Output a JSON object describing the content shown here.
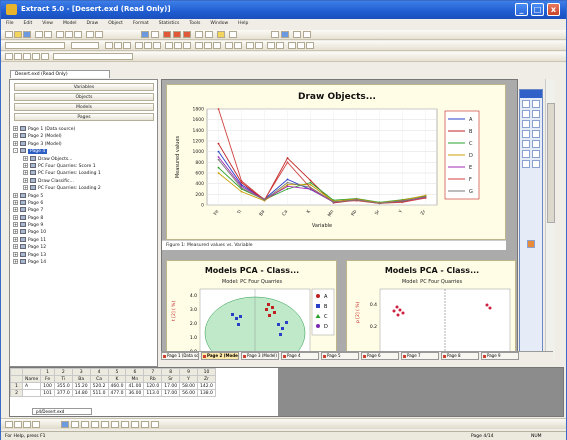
{
  "window": {
    "title": "Extract 5.0 - [Desert.exd (Read Only)]",
    "minimize_glyph": "_",
    "maximize_glyph": "□",
    "close_glyph": "x"
  },
  "menu": [
    "File",
    "Edit",
    "View",
    "Model",
    "Draw",
    "Object",
    "Format",
    "Statistics",
    "Tools",
    "Window",
    "Help"
  ],
  "document_tab": "Desert.exd (Read Only)",
  "left_buttons": [
    "Variables",
    "Objects",
    "Models",
    "Pages"
  ],
  "tree": [
    {
      "label": "Page 1 (Data source)",
      "level": 0,
      "expander": "+"
    },
    {
      "label": "Page 2 (Model)",
      "level": 0,
      "expander": "+"
    },
    {
      "label": "Page 3 (Model)",
      "level": 0,
      "expander": "+"
    },
    {
      "label": "Page 4",
      "level": 0,
      "expander": "-",
      "selected": true
    },
    {
      "label": "Draw Objects...",
      "level": 1,
      "expander": "+"
    },
    {
      "label": "PC Four Quarries: Score 1",
      "level": 1,
      "expander": "+"
    },
    {
      "label": "PC Four Quarries: Loading 1",
      "level": 1,
      "expander": "+"
    },
    {
      "label": "Draw Classific...",
      "level": 1,
      "expander": "+"
    },
    {
      "label": "PC Four Quarries: Loading 2",
      "level": 1,
      "expander": "+"
    },
    {
      "label": "Page 5",
      "level": 0,
      "expander": "+"
    },
    {
      "label": "Page 6",
      "level": 0,
      "expander": "+"
    },
    {
      "label": "Page 7",
      "level": 0,
      "expander": "+"
    },
    {
      "label": "Page 8",
      "level": 0,
      "expander": "+"
    },
    {
      "label": "Page 9",
      "level": 0,
      "expander": "+"
    },
    {
      "label": "Page 10",
      "level": 0,
      "expander": "+"
    },
    {
      "label": "Page 11",
      "level": 0,
      "expander": "+"
    },
    {
      "label": "Page 12",
      "level": 0,
      "expander": "+"
    },
    {
      "label": "Page 13",
      "level": 0,
      "expander": "+"
    },
    {
      "label": "Page 14",
      "level": 0,
      "expander": "+"
    }
  ],
  "figure_caption": "Figure 1: Measured values vs. Variable",
  "small_chart_left": {
    "title": "Models PCA - Class...",
    "subtitle": "Model: PC Four Quarries",
    "ylabel": "t [2] ( %)",
    "yticks": [
      "4.0",
      "3.0",
      "2.0",
      "1.0",
      "0.0"
    ],
    "legend": [
      "A",
      "B",
      "C",
      "D"
    ]
  },
  "small_chart_right": {
    "title": "Models PCA - Class...",
    "subtitle": "Model: PC Four Quarries",
    "ylabel": "p [2] ( %)",
    "yticks": [
      "0.4",
      "0.2"
    ]
  },
  "page_tabs": [
    "Page 1 (Data source)",
    "Page 2 (Model)",
    "Page 3 (Model)",
    "Page 4",
    "Page 5",
    "Page 6",
    "Page 7",
    "Page 8",
    "Page 9"
  ],
  "active_page_tab": 1,
  "grid": {
    "col_numbers": [
      "",
      "1",
      "2",
      "3",
      "4",
      "5",
      "6",
      "7",
      "8",
      "9",
      "10"
    ],
    "header": [
      "Name",
      "Fe",
      "Ti",
      "Ba",
      "Ca",
      "K",
      "Mn",
      "Rb",
      "Sr",
      "Y",
      "Zr"
    ],
    "rows": [
      [
        "A",
        "100",
        "355.0",
        "15.20",
        "520.2",
        "460.0",
        "41.00",
        "120.0",
        "17.00",
        "58.00",
        "142.0"
      ],
      [
        "",
        "101",
        "377.0",
        "14.80",
        "511.0",
        "477.0",
        "36.00",
        "113.0",
        "17.00",
        "56.00",
        "138.0"
      ]
    ],
    "row_numbers": [
      "1",
      "2"
    ],
    "sheet_tab": "p4/Desert.exd"
  },
  "status": {
    "left": "For Help, press F1",
    "page": "Page 4/14",
    "num": "NUM"
  },
  "colors": {
    "accent": "#2c5ec4",
    "titlebar": "#1f5cd0"
  },
  "chart_data": {
    "type": "line",
    "title": "Draw Objects...",
    "xlabel": "Variable",
    "ylabel": "Measured values",
    "categories": [
      "Fe",
      "Ti",
      "Ba",
      "Ca",
      "K",
      "Mn",
      "Rb",
      "Sr",
      "Y",
      "Zr"
    ],
    "ylim": [
      0,
      1800
    ],
    "yticks": [
      0,
      200,
      400,
      600,
      800,
      1000,
      1200,
      1400,
      1600,
      1800
    ],
    "grid": true,
    "legend_position": "right",
    "series": [
      {
        "name": "A",
        "color": "#2a3fc8",
        "values": [
          1000,
          380,
          110,
          480,
          290,
          60,
          100,
          40,
          60,
          160
        ]
      },
      {
        "name": "B",
        "color": "#c02020",
        "values": [
          1150,
          420,
          90,
          880,
          460,
          40,
          90,
          30,
          70,
          150
        ]
      },
      {
        "name": "C",
        "color": "#2aa02a",
        "values": [
          700,
          300,
          100,
          300,
          420,
          90,
          120,
          50,
          100,
          170
        ]
      },
      {
        "name": "D",
        "color": "#c8a000",
        "values": [
          600,
          250,
          80,
          380,
          380,
          70,
          110,
          40,
          90,
          180
        ]
      },
      {
        "name": "E",
        "color": "#a02ab0",
        "values": [
          900,
          350,
          100,
          350,
          300,
          50,
          100,
          30,
          80,
          140
        ]
      },
      {
        "name": "F",
        "color": "#d04040",
        "values": [
          1800,
          450,
          100,
          800,
          320,
          60,
          80,
          30,
          50,
          130
        ]
      },
      {
        "name": "G",
        "color": "#7a7a7a",
        "values": [
          850,
          320,
          95,
          420,
          330,
          55,
          95,
          35,
          75,
          155
        ]
      }
    ]
  }
}
